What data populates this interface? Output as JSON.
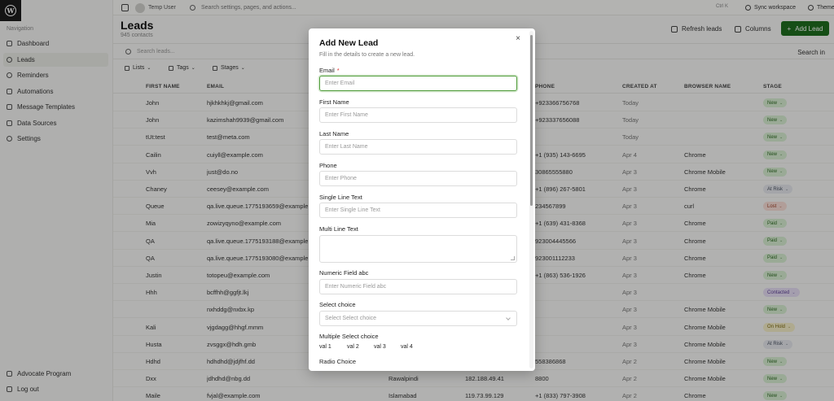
{
  "sidebar": {
    "heading": "Navigation",
    "items": [
      {
        "label": "Dashboard"
      },
      {
        "label": "Leads"
      },
      {
        "label": "Reminders"
      },
      {
        "label": "Automations"
      },
      {
        "label": "Message Templates"
      },
      {
        "label": "Data Sources"
      },
      {
        "label": "Settings"
      }
    ],
    "footer": [
      {
        "label": "Advocate Program"
      },
      {
        "label": "Log out"
      }
    ]
  },
  "topbar": {
    "user": "Temp User",
    "search_placeholder": "Search settings, pages, and actions...",
    "shortcut": "Ctrl K",
    "sync": "Sync workspace",
    "theme": "Theme"
  },
  "page": {
    "title": "Leads",
    "subtitle": "945 contacts",
    "refresh": "Refresh leads",
    "columns": "Columns",
    "add": "Add Lead",
    "search_placeholder": "Search leads...",
    "search_in": "Search in",
    "filters": [
      "Lists",
      "Tags",
      "Stages"
    ]
  },
  "table": {
    "headers": [
      "FIRST NAME",
      "EMAIL",
      "PHONE",
      "CREATED AT",
      "BROWSER NAME",
      "STAGE"
    ],
    "rows": [
      {
        "first": "John",
        "email": "hjkhkhkj@gmail.com",
        "city": "",
        "ip": "",
        "phone": "+923366756768",
        "created": "Today",
        "browser": "",
        "stage": "New"
      },
      {
        "first": "John",
        "email": "kazimshah9939@gmail.com",
        "city": "",
        "ip": "",
        "phone": "+923337656088",
        "created": "Today",
        "browser": "",
        "stage": "New"
      },
      {
        "first": "tUt:test",
        "email": "test@meta.com",
        "city": "",
        "ip": "",
        "phone": "",
        "created": "Today",
        "browser": "",
        "stage": "New"
      },
      {
        "first": "Cailin",
        "email": "cuiyll@example.com",
        "city": "",
        "ip": "",
        "phone": "+1 (935) 143-6695",
        "created": "Apr 4",
        "browser": "Chrome",
        "stage": "New"
      },
      {
        "first": "Vvh",
        "email": "just@do.no",
        "city": "",
        "ip": "",
        "phone": "30865555880",
        "created": "Apr 3",
        "browser": "Chrome Mobile",
        "stage": "New"
      },
      {
        "first": "Chaney",
        "email": "ceesey@example.com",
        "city": "",
        "ip": "",
        "phone": "+1 (896) 267-5801",
        "created": "Apr 3",
        "browser": "Chrome",
        "stage": "At Risk"
      },
      {
        "first": "Queue",
        "email": "qa.live.queue.1775193659@example",
        "city": "",
        "ip": "",
        "phone": "234567899",
        "created": "Apr 3",
        "browser": "curl",
        "stage": "Lost"
      },
      {
        "first": "Mia",
        "email": "zowizyqyno@example.com",
        "city": "",
        "ip": "",
        "phone": "+1 (639) 431-8368",
        "created": "Apr 3",
        "browser": "Chrome",
        "stage": "Paid"
      },
      {
        "first": "QA",
        "email": "qa.live.queue.1775193188@example",
        "city": "",
        "ip": "",
        "phone": "923004445566",
        "created": "Apr 3",
        "browser": "Chrome",
        "stage": "Paid"
      },
      {
        "first": "QA",
        "email": "qa.live.queue.1775193080@example",
        "city": "",
        "ip": "",
        "phone": "923001112233",
        "created": "Apr 3",
        "browser": "Chrome",
        "stage": "Paid"
      },
      {
        "first": "Justin",
        "email": "totopeu@example.com",
        "city": "",
        "ip": "",
        "phone": "+1 (863) 536-1926",
        "created": "Apr 3",
        "browser": "Chrome",
        "stage": "New"
      },
      {
        "first": "Hhh",
        "email": "bcffhh@ggfjt.lkj",
        "city": "",
        "ip": "",
        "phone": "",
        "created": "Apr 3",
        "browser": "",
        "stage": "Contacted"
      },
      {
        "first": "",
        "email": "nxhddg@nxbx.kp",
        "city": "",
        "ip": "",
        "phone": "",
        "created": "Apr 3",
        "browser": "Chrome Mobile",
        "stage": "New"
      },
      {
        "first": "Kali",
        "email": "vjgdagg@hhgf.mmm",
        "city": "",
        "ip": "",
        "phone": "",
        "created": "Apr 3",
        "browser": "Chrome Mobile",
        "stage": "On Hold"
      },
      {
        "first": "Husta",
        "email": "zvsggx@hdh.gmb",
        "city": "",
        "ip": "",
        "phone": "",
        "created": "Apr 3",
        "browser": "Chrome Mobile",
        "stage": "At Risk"
      },
      {
        "first": "Hdhd",
        "email": "hdhdhd@jdjfhf.dd",
        "city": "",
        "ip": "",
        "phone": "558386868",
        "created": "Apr 2",
        "browser": "Chrome Mobile",
        "stage": "New"
      },
      {
        "first": "Dxx",
        "email": "jdhdhd@nbg.dd",
        "city": "Rawalpindi",
        "ip": "182.188.49.41",
        "phone": "8800",
        "created": "Apr 2",
        "browser": "Chrome Mobile",
        "stage": "New"
      },
      {
        "first": "Maile",
        "email": "fvjal@example.com",
        "city": "Islamabad",
        "ip": "119.73.99.129",
        "phone": "+1 (833) 797-3908",
        "created": "Apr 2",
        "browser": "Chrome",
        "stage": "New"
      }
    ]
  },
  "stage_colors": {
    "New": {
      "bg": "#d6ecd0",
      "fg": "#2d6a23"
    },
    "At Risk": {
      "bg": "#e3e5ea",
      "fg": "#4a5262"
    },
    "Lost": {
      "bg": "#f5dcd4",
      "fg": "#9b3c25"
    },
    "Paid": {
      "bg": "#d6ecd0",
      "fg": "#2d6a23"
    },
    "Contacted": {
      "bg": "#e4dcf2",
      "fg": "#5b3d93"
    },
    "On Hold": {
      "bg": "#f3ecc6",
      "fg": "#7d6a12"
    }
  },
  "modal": {
    "title": "Add New Lead",
    "subtitle": "Fill in the details to create a new lead.",
    "fields": [
      {
        "label": "Email",
        "required": "*",
        "placeholder": "Enter Email"
      },
      {
        "label": "First Name",
        "placeholder": "Enter First Name"
      },
      {
        "label": "Last Name",
        "placeholder": "Enter Last Name"
      },
      {
        "label": "Phone",
        "placeholder": "Enter Phone"
      },
      {
        "label": "Single Line Text",
        "placeholder": "Enter Single Line Text"
      },
      {
        "label": "Multi Line Text",
        "placeholder": ""
      },
      {
        "label": "Numeric Field abc",
        "placeholder": "Enter Numeric Field abc"
      },
      {
        "label": "Select choice",
        "placeholder": "Select Select choice"
      },
      {
        "label": "Multiple Select choice"
      },
      {
        "label": "Radio Choice"
      }
    ],
    "multi_options": [
      "val 1",
      "val 2",
      "val 3",
      "val 4"
    ]
  },
  "accent": "#1f6d1f"
}
